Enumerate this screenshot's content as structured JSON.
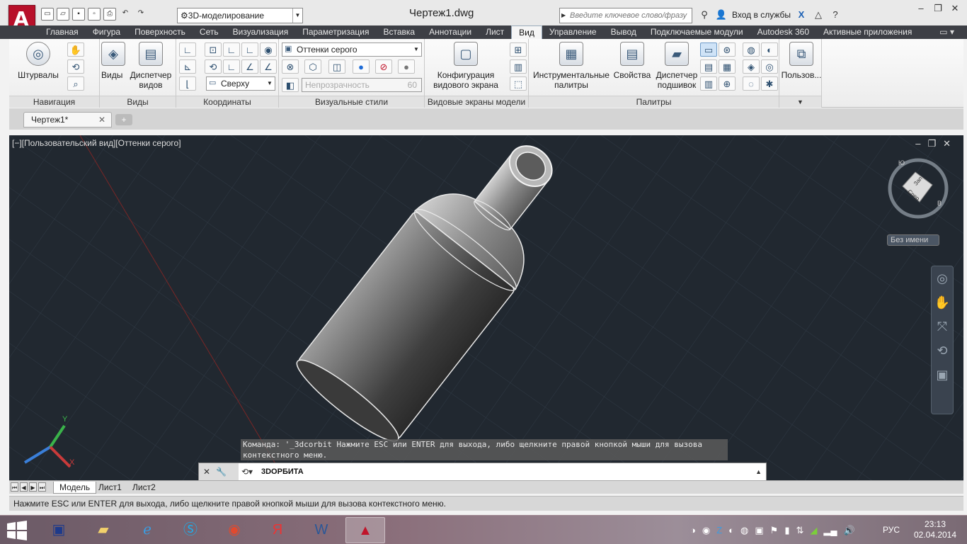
{
  "titlebar": {
    "logo_letter": "A",
    "workspace": "3D-моделирование",
    "doc_title": "Чертеж1.dwg",
    "search_placeholder": "Введите ключевое слово/фразу",
    "signin": "Вход в службы"
  },
  "ribbon_tabs": [
    "Главная",
    "Фигура",
    "Поверхность",
    "Сеть",
    "Визуализация",
    "Параметризация",
    "Вставка",
    "Аннотации",
    "Лист",
    "Вид",
    "Управление",
    "Вывод",
    "Подключаемые модули",
    "Autodesk 360",
    "Активные приложения"
  ],
  "active_tab": "Вид",
  "ribbon": {
    "nav": {
      "title": "Навигация",
      "steering": "Штурвалы"
    },
    "views": {
      "title": "Виды",
      "views": "Виды",
      "manager_line1": "Диспетчер",
      "manager_line2": "видов"
    },
    "coords": {
      "title": "Координаты",
      "combo": "Сверху"
    },
    "visual": {
      "title": "Визуальные стили",
      "combo": "Оттенки серого",
      "opacity_label": "Непрозрачность",
      "opacity_value": "60"
    },
    "viewports": {
      "title": "Видовые экраны модели",
      "config_line1": "Конфигурация",
      "config_line2": "видового экрана"
    },
    "palettes": {
      "title": "Палитры",
      "tool_line1": "Инструментальные",
      "tool_line2": "палитры",
      "props": "Свойства",
      "sheet_line1": "Диспетчер",
      "sheet_line2": "подшивок"
    },
    "user": {
      "label": "Пользов..."
    }
  },
  "doc_tab": {
    "label": "Чертеж1*"
  },
  "viewport": {
    "label": "[−][Пользовательский вид][Оттенки серого]",
    "named_view": "Без имени",
    "cube_faces": {
      "west": "Зап",
      "front": "Спер"
    },
    "compass": {
      "s": "Ю",
      "e": "В"
    },
    "axes": {
      "x": "X",
      "y": "Y"
    }
  },
  "command": {
    "history_line1": "Команда: '_3dcorbit Нажмите ESC или ENTER для выхода, либо щелкните правой кнопкой мыши для вызова",
    "history_line2": "контекстного меню.",
    "current": "3DОРБИТА"
  },
  "layout_tabs": [
    "Модель",
    "Лист1",
    "Лист2"
  ],
  "status_text": "Нажмите ESC или ENTER для выхода, либо щелкните правой кнопкой мыши для вызова контекстного меню.",
  "taskbar": {
    "lang": "РУС",
    "time": "23:13",
    "date": "02.04.2014"
  },
  "colors": {
    "accent": "#b8102a",
    "viewport_bg": "#212830",
    "ribbon_tabs_bg": "#3d3f45"
  }
}
